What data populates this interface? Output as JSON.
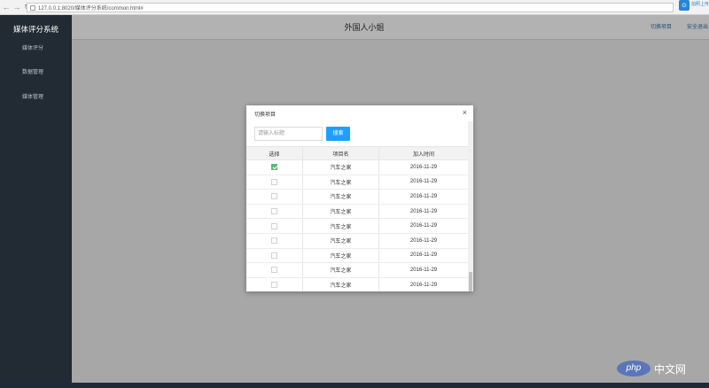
{
  "browser": {
    "url": "127.0.0.1:8020/媒体评分系统/common.html#",
    "extension_label": "拍照上传"
  },
  "sidebar": {
    "title": "媒体评分系统",
    "items": [
      {
        "label": "媒体评分"
      },
      {
        "label": "数据管理"
      },
      {
        "label": "媒体管理"
      }
    ]
  },
  "header": {
    "title": "外国人小姐",
    "switch_project": "切换项目",
    "logout": "安全退出"
  },
  "modal": {
    "title": "切换项目",
    "close": "×",
    "search_placeholder": "请输入标题",
    "search_button": "搜索",
    "columns": [
      "选择",
      "项目名",
      "加入时间"
    ],
    "rows": [
      {
        "checked": true,
        "name": "汽车之家",
        "date": "2016-11-29"
      },
      {
        "checked": false,
        "name": "汽车之家",
        "date": "2016-11-29"
      },
      {
        "checked": false,
        "name": "汽车之家",
        "date": "2016-11-29"
      },
      {
        "checked": false,
        "name": "汽车之家",
        "date": "2016-11-29"
      },
      {
        "checked": false,
        "name": "汽车之家",
        "date": "2016-11-29"
      },
      {
        "checked": false,
        "name": "汽车之家",
        "date": "2016-11-29"
      },
      {
        "checked": false,
        "name": "汽车之家",
        "date": "2016-11-29"
      },
      {
        "checked": false,
        "name": "汽车之家",
        "date": "2016-11-29"
      },
      {
        "checked": false,
        "name": "汽车之家",
        "date": "2016-11-29"
      }
    ]
  },
  "watermark": {
    "badge": "php",
    "text": "中文网"
  },
  "colors": {
    "sidebar_bg": "#222b33",
    "overlay_bg": "#a7a7a7",
    "primary_button": "#1e9fff",
    "checkbox_checked": "#5fb878"
  }
}
